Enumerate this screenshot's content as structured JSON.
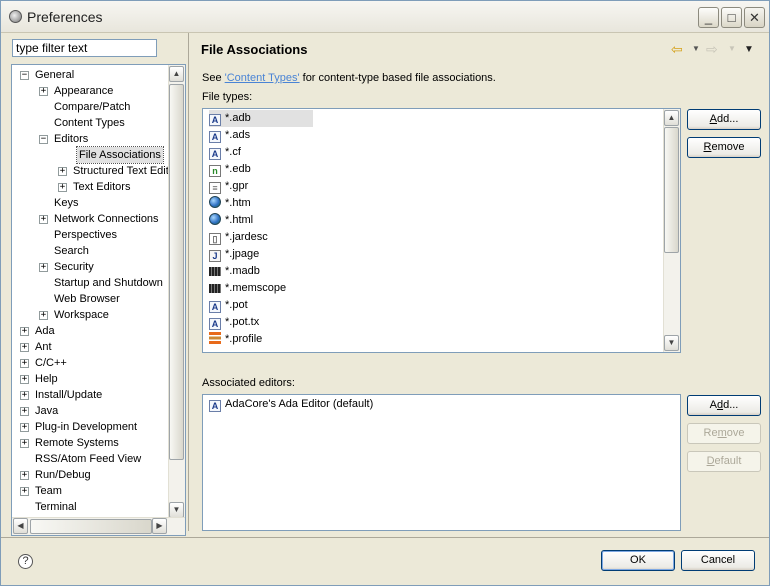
{
  "window": {
    "title": "Preferences",
    "controls": {
      "minimize": "_",
      "maximize": "□",
      "close": "✕"
    }
  },
  "filter": {
    "value": "type filter text"
  },
  "tree": [
    {
      "label": "General",
      "expander": "−"
    },
    {
      "label": "Appearance",
      "expander": "+"
    },
    {
      "label": "Compare/Patch",
      "expander": ""
    },
    {
      "label": "Content Types",
      "expander": ""
    },
    {
      "label": "Editors",
      "expander": "−"
    },
    {
      "label": "File Associations",
      "expander": "",
      "selected": true
    },
    {
      "label": "Structured Text Edit",
      "expander": "+"
    },
    {
      "label": "Text Editors",
      "expander": "+"
    },
    {
      "label": "Keys",
      "expander": ""
    },
    {
      "label": "Network Connections",
      "expander": "+"
    },
    {
      "label": "Perspectives",
      "expander": ""
    },
    {
      "label": "Search",
      "expander": ""
    },
    {
      "label": "Security",
      "expander": "+"
    },
    {
      "label": "Startup and Shutdown",
      "expander": ""
    },
    {
      "label": "Web Browser",
      "expander": ""
    },
    {
      "label": "Workspace",
      "expander": "+"
    },
    {
      "label": "Ada",
      "expander": "+"
    },
    {
      "label": "Ant",
      "expander": "+"
    },
    {
      "label": "C/C++",
      "expander": "+"
    },
    {
      "label": "Help",
      "expander": "+"
    },
    {
      "label": "Install/Update",
      "expander": "+"
    },
    {
      "label": "Java",
      "expander": "+"
    },
    {
      "label": "Plug-in Development",
      "expander": "+"
    },
    {
      "label": "Remote Systems",
      "expander": "+"
    },
    {
      "label": "RSS/Atom Feed View",
      "expander": ""
    },
    {
      "label": "Run/Debug",
      "expander": "+"
    },
    {
      "label": "Team",
      "expander": "+"
    },
    {
      "label": "Terminal",
      "expander": ""
    }
  ],
  "page": {
    "title": "File Associations",
    "see_prefix": "See ",
    "see_link": "'Content Types'",
    "see_suffix": " for content-type based file associations.",
    "file_types_label": "File types:",
    "associated_editors_label": "Associated editors:"
  },
  "file_types": [
    {
      "name": "*.adb",
      "icon": "ada-file-icon",
      "selected": true
    },
    {
      "name": "*.ads",
      "icon": "ada-file-icon"
    },
    {
      "name": "*.cf",
      "icon": "ada-file-icon"
    },
    {
      "name": "*.edb",
      "icon": "green-doc-icon"
    },
    {
      "name": "*.gpr",
      "icon": "text-doc-icon"
    },
    {
      "name": "*.htm",
      "icon": "globe-icon"
    },
    {
      "name": "*.html",
      "icon": "globe-icon"
    },
    {
      "name": "*.jardesc",
      "icon": "jar-doc-icon"
    },
    {
      "name": "*.jpage",
      "icon": "java-page-icon"
    },
    {
      "name": "*.madb",
      "icon": "memory-chip-icon"
    },
    {
      "name": "*.memscope",
      "icon": "memory-chip-icon"
    },
    {
      "name": "*.pot",
      "icon": "ada-file-icon"
    },
    {
      "name": "*.pot.tx",
      "icon": "ada-file-icon"
    },
    {
      "name": "*.profile",
      "icon": "profile-icon"
    }
  ],
  "editors": [
    {
      "name": "AdaCore's Ada Editor (default)",
      "icon": "ada-file-icon"
    }
  ],
  "buttons": {
    "add_types_pre": "",
    "add_types_u": "A",
    "add_types_post": "dd...",
    "remove_types_pre": "",
    "remove_types_u": "R",
    "remove_types_post": "emove",
    "add_editor_pre": "A",
    "add_editor_u": "d",
    "add_editor_post": "d...",
    "remove_editor_pre": "Re",
    "remove_editor_u": "m",
    "remove_editor_post": "ove",
    "default_pre": "",
    "default_u": "D",
    "default_post": "efault",
    "ok": "OK",
    "cancel": "Cancel"
  },
  "icons": {
    "help": "?",
    "back": "⇦",
    "forward": "⇨",
    "menu": "▼"
  },
  "colors": {
    "link": "#4a84d5",
    "selection": "#e1e1e1",
    "border": "#7f9db9"
  }
}
